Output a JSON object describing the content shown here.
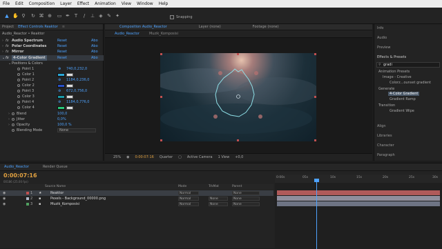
{
  "menu": [
    "File",
    "Edit",
    "Composition",
    "Layer",
    "Effect",
    "Animation",
    "View",
    "Window",
    "Help"
  ],
  "toolbar": {
    "snapping": "Snapping"
  },
  "left": {
    "project_tab": "Project",
    "fx_tab": "Effect Controls Reaktor",
    "breadcrumb": "Audio_Reactor • Reaktor",
    "effects": [
      {
        "name": "Audio Spectrum",
        "reset": "Reset",
        "about": "Abo"
      },
      {
        "name": "Polar Coordinates",
        "reset": "Reset",
        "about": "Abo"
      },
      {
        "name": "Mirror",
        "reset": "Reset",
        "about": "Abo"
      },
      {
        "name": "4-Color Gradient",
        "reset": "Reset",
        "about": "Abo"
      }
    ],
    "group": "Positions & Colors",
    "points": [
      {
        "label": "Point 1",
        "value": "740,0,232,0"
      },
      {
        "label": "Color 1",
        "color": "#2aa8d8"
      },
      {
        "label": "Point 2",
        "value": "1184,0,236,0"
      },
      {
        "label": "Color 2",
        "color": "#2850c8"
      },
      {
        "label": "Point 3",
        "value": "672,0,756,0"
      },
      {
        "label": "Color 3",
        "color": "#1a9aa8"
      },
      {
        "label": "Point 4",
        "value": "1184,0,776,0"
      },
      {
        "label": "Color 4",
        "color": "#28c878"
      }
    ],
    "props": [
      {
        "label": "Blend",
        "value": "100,0"
      },
      {
        "label": "Jitter",
        "value": "0,0%"
      },
      {
        "label": "Opacity",
        "value": "100,0 %"
      },
      {
        "label": "Blending Mode",
        "value": "None"
      }
    ]
  },
  "viewer": {
    "comp_tab": "Composition Audio_Reactor",
    "layer_tab": "Layer (none)",
    "footage_tab": "Footage (none)",
    "sub_tabs": [
      "Audio_Reactor",
      "Muzik_Komposisi"
    ],
    "zoom": "25%",
    "timecode": "0:00:07:16",
    "quality": "Quarter",
    "camera": "Active Camera",
    "views": "1 View",
    "exposure": "+0,0"
  },
  "right": {
    "items": [
      "Info",
      "Audio",
      "Preview"
    ],
    "effects_presets": "Effects & Presets",
    "search": "gradi",
    "tree": [
      "Animation Presets",
      "Image - Creative",
      "Colorz...ounset gradient",
      "Generate",
      "4-Color Gradient",
      "Gradient Ramp",
      "Transition",
      "Gradient Wipe"
    ],
    "bottom": [
      "Align",
      "Libraries",
      "Character",
      "Paragraph"
    ]
  },
  "timeline": {
    "tab": "Audio_Reactor",
    "render_queue": "Render Queue",
    "timecode": "0:00:07:16",
    "fps": "00186 (25.00 fps)",
    "columns": {
      "source": "Source Name",
      "mode": "Mode",
      "trkmat": "TrkMat",
      "parent": "Parent"
    },
    "layers": [
      {
        "num": "1",
        "name": "Reaktor",
        "mode": "Normal",
        "trkmat": "",
        "parent": "None",
        "color": "#c05050"
      },
      {
        "num": "2",
        "name": "Pexels - Background_00000.png",
        "mode": "Normal",
        "trkmat": "None",
        "parent": "None",
        "color": "#b0b8c8"
      },
      {
        "num": "3",
        "name": "Muzik_Komposisi",
        "mode": "Normal",
        "trkmat": "None",
        "parent": "None",
        "color": "#50a060"
      }
    ],
    "ruler": [
      "0:00s",
      "05s",
      "10s",
      "15s",
      "20s",
      "25s",
      "30s"
    ],
    "playhead_seconds": 7.6
  }
}
